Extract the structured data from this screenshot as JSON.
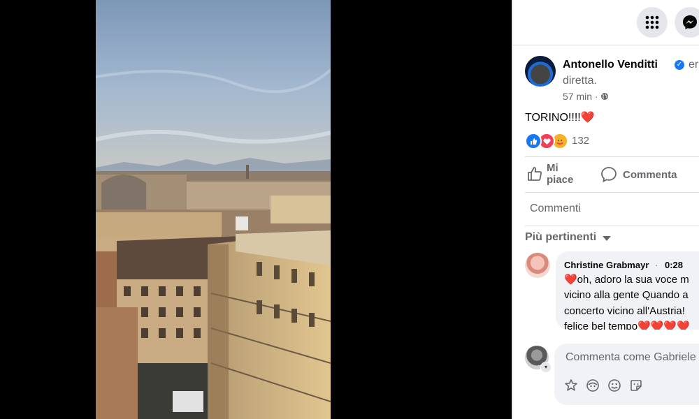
{
  "post": {
    "author": "Antonello Venditti",
    "status_line1": "era in",
    "status_line2": "diretta.",
    "time": "57 min",
    "meta_sep": "·",
    "text": "TORINO!!!!",
    "text_emoji": "❤️",
    "reaction_count": "132"
  },
  "actions": {
    "like_line1": "Mi",
    "like_line2": "piace",
    "comment": "Commenta"
  },
  "comments": {
    "header": "Commenti",
    "sort_label": "Più pertinenti",
    "items": [
      {
        "author": "Christine Grabmayr",
        "time": "0:28",
        "lines": [
          "❤️oh, adoro la sua voce m",
          "vicino alla gente Quando a",
          "concerto vicino all'Austria!",
          "felice bel tempo❤️❤️❤️❤️"
        ]
      }
    ],
    "composer_placeholder": "Commenta come Gabriele"
  },
  "icons": [
    "menu-grid-icon",
    "messenger-icon",
    "globe-icon",
    "like-reaction-icon",
    "love-reaction-icon",
    "care-reaction-icon",
    "thumbs-up-icon",
    "comment-bubble-icon",
    "chevron-down-icon",
    "sticker-icon",
    "avatar-sticker-icon",
    "emoji-icon",
    "gif-sticker-icon"
  ],
  "colors": {
    "brand_blue": "#1877f2",
    "love_red": "#f33e58",
    "care_yellow": "#f7b125",
    "bubble_bg": "#f0f2f5",
    "muted_text": "#65676b"
  }
}
